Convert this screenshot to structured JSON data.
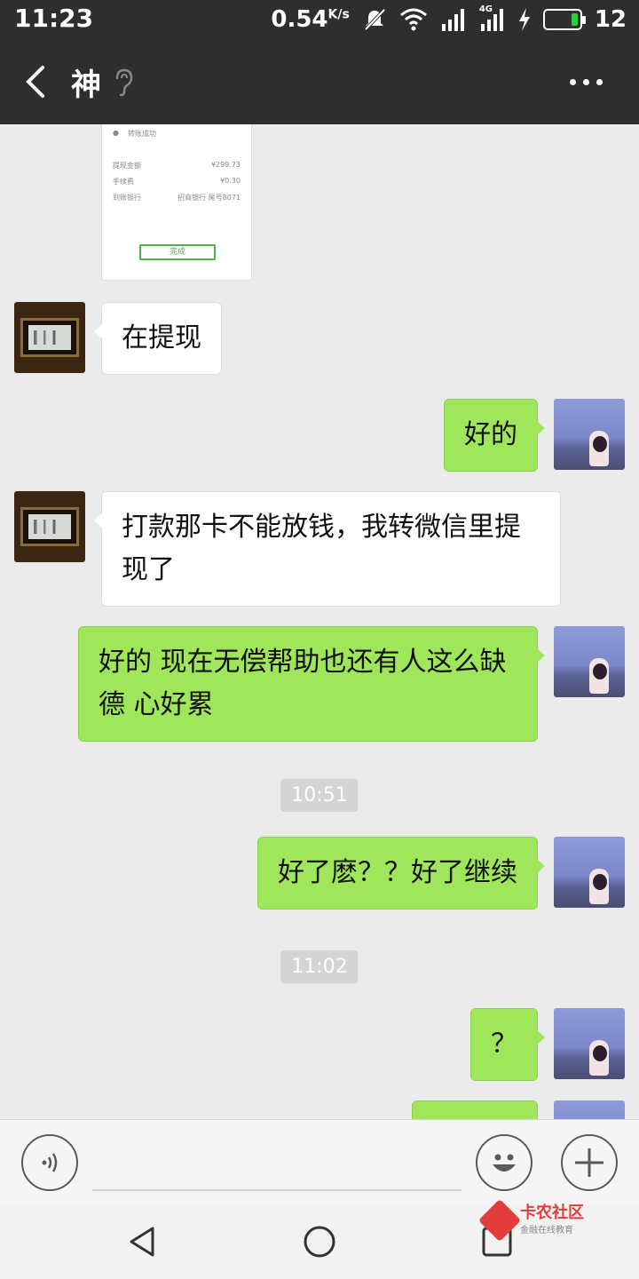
{
  "status_bar": {
    "time": "11:23",
    "net_speed": "0.54",
    "net_unit": "K/s",
    "signal_label": "4G",
    "battery": "12"
  },
  "header": {
    "title": "神",
    "icons": [
      "back-icon",
      "ear-icon",
      "more-icon"
    ]
  },
  "screenshot_card": {
    "line1": "转账成功",
    "row1_left": "提现金额",
    "row1_right": "¥299.73",
    "row2_left": "手续费",
    "row2_right": "¥0.30",
    "row3_left": "到账银行",
    "row3_right": "招商银行 尾号8071",
    "done_label": "完成"
  },
  "messages": [
    {
      "side": "left",
      "text": "在提现"
    },
    {
      "side": "right",
      "text": "好的"
    },
    {
      "side": "left",
      "text": "打款那卡不能放钱，我转微信里提现了"
    },
    {
      "side": "right",
      "text": "好的  现在无偿帮助也还有人这么缺德  心好累"
    },
    {
      "type": "time",
      "text": "10:51"
    },
    {
      "side": "right",
      "text": "好了麽？？好了继续"
    },
    {
      "type": "time",
      "text": "11:02"
    },
    {
      "side": "right",
      "text": "？"
    }
  ],
  "input_bar": {
    "icons": [
      "voice-icon",
      "emoji-icon",
      "plus-icon"
    ]
  },
  "watermark": {
    "name": "卡农社区",
    "sub": "金融在线教育"
  },
  "colors": {
    "header_bg": "#2e2e2e",
    "chat_bg": "#ebebeb",
    "bubble_right": "#9fe65a",
    "bubble_left": "#ffffff"
  }
}
